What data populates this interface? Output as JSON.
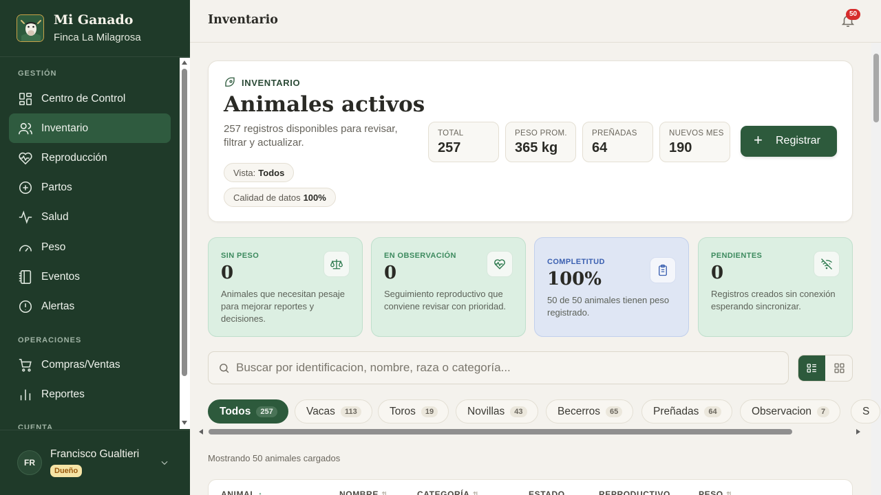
{
  "brand": {
    "title": "Mi Ganado",
    "subtitle": "Finca La Milagrosa"
  },
  "nav": {
    "section_gestion": "GESTIÓN",
    "section_operaciones": "OPERACIONES",
    "section_cuenta": "CUENTA",
    "items": [
      {
        "label": "Centro de Control",
        "icon": "grid-icon"
      },
      {
        "label": "Inventario",
        "icon": "users-icon",
        "active": true
      },
      {
        "label": "Reproducción",
        "icon": "heart-pulse-icon"
      },
      {
        "label": "Partos",
        "icon": "plus-circle-icon"
      },
      {
        "label": "Salud",
        "icon": "activity-icon"
      },
      {
        "label": "Peso",
        "icon": "gauge-icon"
      },
      {
        "label": "Eventos",
        "icon": "notebook-icon"
      },
      {
        "label": "Alertas",
        "icon": "alert-circle-icon"
      },
      {
        "label": "Compras/Ventas",
        "icon": "cart-icon"
      },
      {
        "label": "Reportes",
        "icon": "bar-chart-icon"
      }
    ]
  },
  "user": {
    "initials": "FR",
    "name": "Francisco Gualtieri",
    "role": "Dueño"
  },
  "topbar": {
    "title": "Inventario",
    "notifications": "50"
  },
  "hero": {
    "kicker": "INVENTARIO",
    "title": "Animales activos",
    "description": "257 registros disponibles para revisar, filtrar y actualizar.",
    "view_label": "Vista:",
    "view_value": "Todos",
    "quality_label": "Calidad de datos",
    "quality_value": "100%",
    "stats": [
      {
        "label": "TOTAL",
        "value": "257"
      },
      {
        "label": "PESO PROM.",
        "value": "365 kg"
      },
      {
        "label": "PREÑADAS",
        "value": "64"
      },
      {
        "label": "NUEVOS MES",
        "value": "190"
      }
    ],
    "register_label": "Registrar"
  },
  "cards": [
    {
      "label": "SIN PESO",
      "value": "0",
      "desc": "Animales que necesitan pesaje para mejorar reportes y decisiones.",
      "icon": "scale-icon"
    },
    {
      "label": "EN OBSERVACIÓN",
      "value": "0",
      "desc": "Seguimiento reproductivo que conviene revisar con prioridad.",
      "icon": "heart-pulse-icon"
    },
    {
      "label": "COMPLETITUD",
      "value": "100%",
      "desc": "50 de 50 animales tienen peso registrado.",
      "icon": "clipboard-icon"
    },
    {
      "label": "PENDIENTES",
      "value": "0",
      "desc": "Registros creados sin conexión esperando sincronizar.",
      "icon": "wifi-off-icon"
    }
  ],
  "search": {
    "placeholder": "Buscar por identificacion, nombre, raza o categoría..."
  },
  "tabs": [
    {
      "label": "Todos",
      "count": "257"
    },
    {
      "label": "Vacas",
      "count": "113"
    },
    {
      "label": "Toros",
      "count": "19"
    },
    {
      "label": "Novillas",
      "count": "43"
    },
    {
      "label": "Becerros",
      "count": "65"
    },
    {
      "label": "Preñadas",
      "count": "64"
    },
    {
      "label": "Observacion",
      "count": "7"
    },
    {
      "label": "S",
      "count": ""
    }
  ],
  "list": {
    "showing": "Mostrando 50 animales cargados",
    "columns": [
      "ANIMAL",
      "NOMBRE",
      "CATEGORÍA",
      "ESTADO",
      "REPRODUCTIVO",
      "PESO"
    ]
  },
  "colors": {
    "sidebar": "#1f3a29",
    "accent": "#2d5a3c",
    "badge": "#d62c2c",
    "card_green": "#dcefe2",
    "card_blue": "#dfe6f4"
  }
}
